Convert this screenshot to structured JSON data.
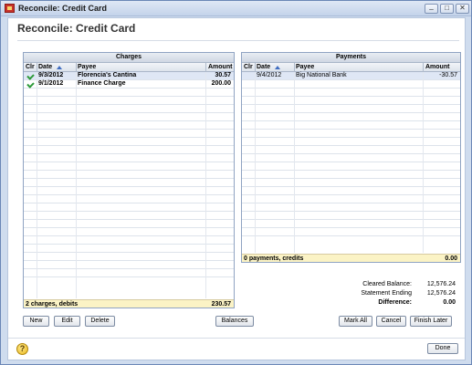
{
  "window": {
    "title": "Reconcile: Credit Card"
  },
  "heading": "Reconcile: Credit Card",
  "charges": {
    "title": "Charges",
    "columns": {
      "clr": "Clr",
      "date": "Date",
      "payee": "Payee",
      "amount": "Amount"
    },
    "rows": [
      {
        "cleared": true,
        "date": "9/3/2012",
        "payee": "Florencia's Cantina",
        "amount": "30.57"
      },
      {
        "cleared": true,
        "date": "9/1/2012",
        "payee": "Finance Charge",
        "amount": "200.00"
      }
    ],
    "footer_label": "2 charges, debits",
    "footer_total": "230.57"
  },
  "payments": {
    "title": "Payments",
    "columns": {
      "clr": "Clr",
      "date": "Date",
      "payee": "Payee",
      "amount": "Amount"
    },
    "rows": [
      {
        "cleared": false,
        "date": "9/4/2012",
        "payee": "Big National Bank",
        "amount": "-30.57"
      }
    ],
    "footer_label": "0 payments, credits",
    "footer_total": "0.00"
  },
  "summary": {
    "cleared_balance_label": "Cleared Balance:",
    "cleared_balance": "12,576.24",
    "statement_ending_label": "Statement Ending",
    "statement_ending": "12,576.24",
    "difference_label": "Difference:",
    "difference": "0.00"
  },
  "buttons": {
    "new": "New",
    "edit": "Edit",
    "delete": "Delete",
    "balances": "Balances",
    "mark_all": "Mark All",
    "cancel": "Cancel",
    "finish_later": "Finish Later",
    "done": "Done"
  },
  "help_glyph": "?",
  "colors": {
    "footer_bg": "#fbf3c5",
    "selected_row": "#dfe7f5",
    "check": "#2e9a3a"
  }
}
